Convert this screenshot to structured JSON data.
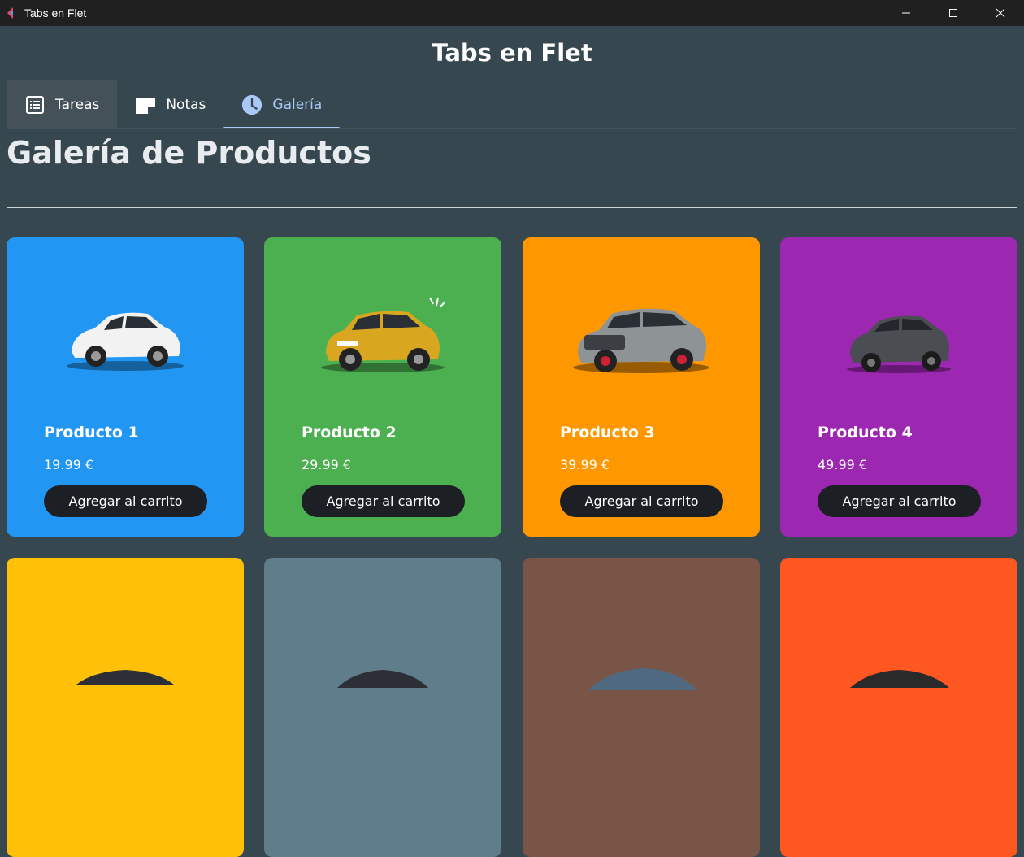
{
  "window": {
    "title": "Tabs en Flet"
  },
  "app": {
    "title": "Tabs en Flet"
  },
  "tabs": [
    {
      "label": "Tareas",
      "icon": "list-alt-icon"
    },
    {
      "label": "Notas",
      "icon": "note-icon"
    },
    {
      "label": "Galería",
      "icon": "clock-icon",
      "selected": true
    }
  ],
  "gallery": {
    "heading": "Galería de Productos",
    "button_label": "Agregar al carrito",
    "products": [
      {
        "name": "Producto 1",
        "price": "19.99 €",
        "color": "#2196f3",
        "car": "white-hatchback"
      },
      {
        "name": "Producto 2",
        "price": "29.99 €",
        "color": "#4caf50",
        "car": "yellow-suv"
      },
      {
        "name": "Producto 3",
        "price": "39.99 €",
        "color": "#ff9800",
        "car": "gray-suv"
      },
      {
        "name": "Producto 4",
        "price": "49.99 €",
        "color": "#9c27b0",
        "car": "dark-crossover"
      },
      {
        "color": "#ffc107",
        "car": "dark-car"
      },
      {
        "color": "#607d8b",
        "car": "dark-car"
      },
      {
        "color": "#795548",
        "car": "dark-car"
      },
      {
        "color": "#ff5722",
        "car": "dark-car"
      }
    ]
  },
  "colors": {
    "background": "#37474f",
    "titlebar": "#202020",
    "tab_indicator": "#a9c8f5",
    "button": "#1c1f24"
  }
}
